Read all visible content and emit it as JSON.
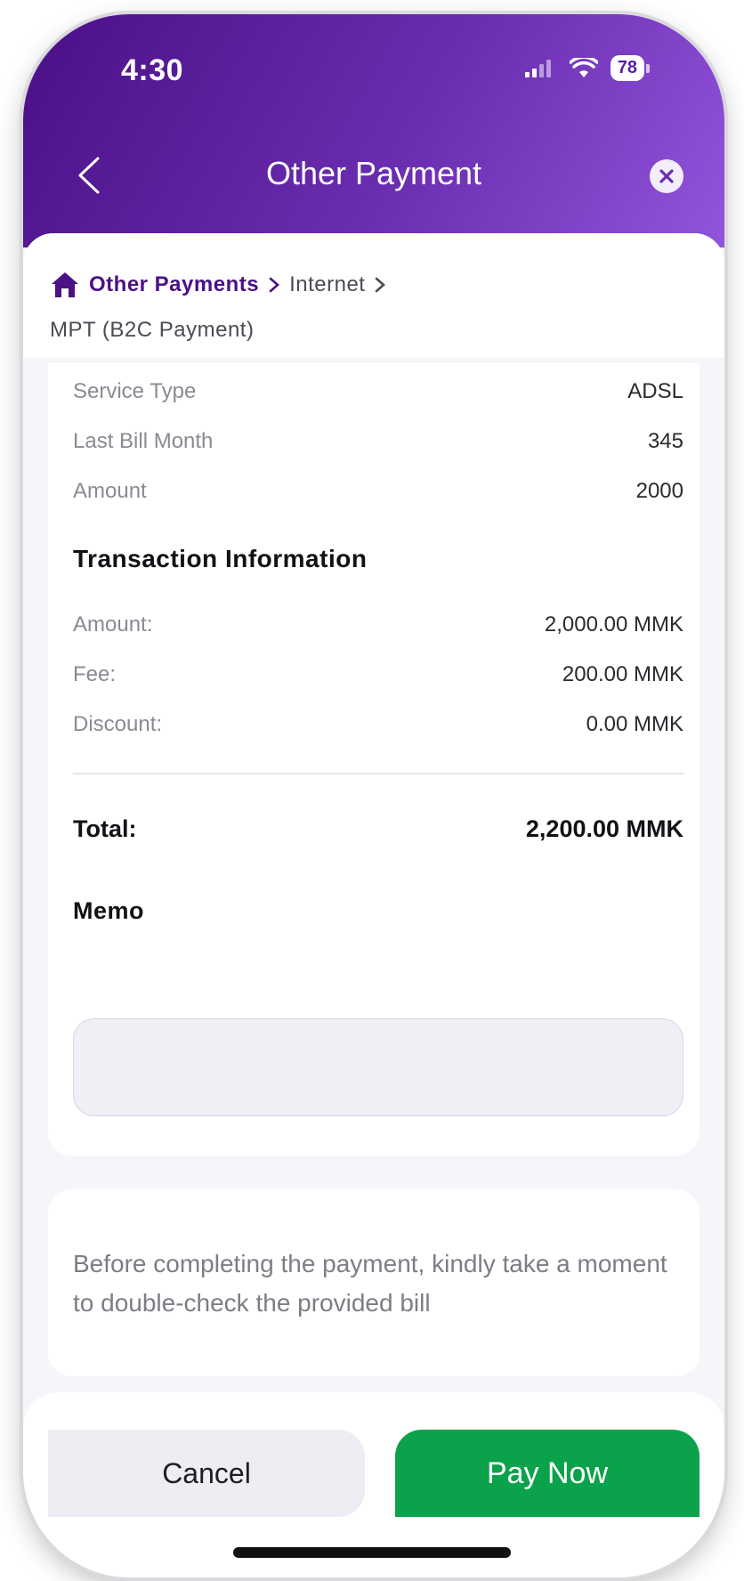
{
  "status_bar": {
    "time": "4:30",
    "battery": "78"
  },
  "header": {
    "title": "Other Payment"
  },
  "breadcrumb": {
    "items": [
      "Other Payments",
      "Internet",
      "MPT (B2C Payment)"
    ]
  },
  "bill_details": [
    {
      "label": "Service Type",
      "value": "ADSL"
    },
    {
      "label": "Last Bill Month",
      "value": "345"
    },
    {
      "label": "Amount",
      "value": "2000"
    }
  ],
  "transaction": {
    "title": "Transaction Information",
    "rows": [
      {
        "label": "Amount:",
        "value": "2,000.00 MMK"
      },
      {
        "label": "Fee:",
        "value": "200.00 MMK"
      },
      {
        "label": "Discount:",
        "value": "0.00 MMK"
      }
    ],
    "total_label": "Total:",
    "total_value": "2,200.00 MMK"
  },
  "memo": {
    "title": "Memo",
    "value": "",
    "placeholder": ""
  },
  "note": {
    "text": "Before completing the payment, kindly take a moment to double-check the provided bill"
  },
  "actions": {
    "cancel_label": "Cancel",
    "pay_label": "Pay Now"
  },
  "colors": {
    "brand_purple": "#5b1ea3",
    "pay_green": "#0aa24a"
  }
}
